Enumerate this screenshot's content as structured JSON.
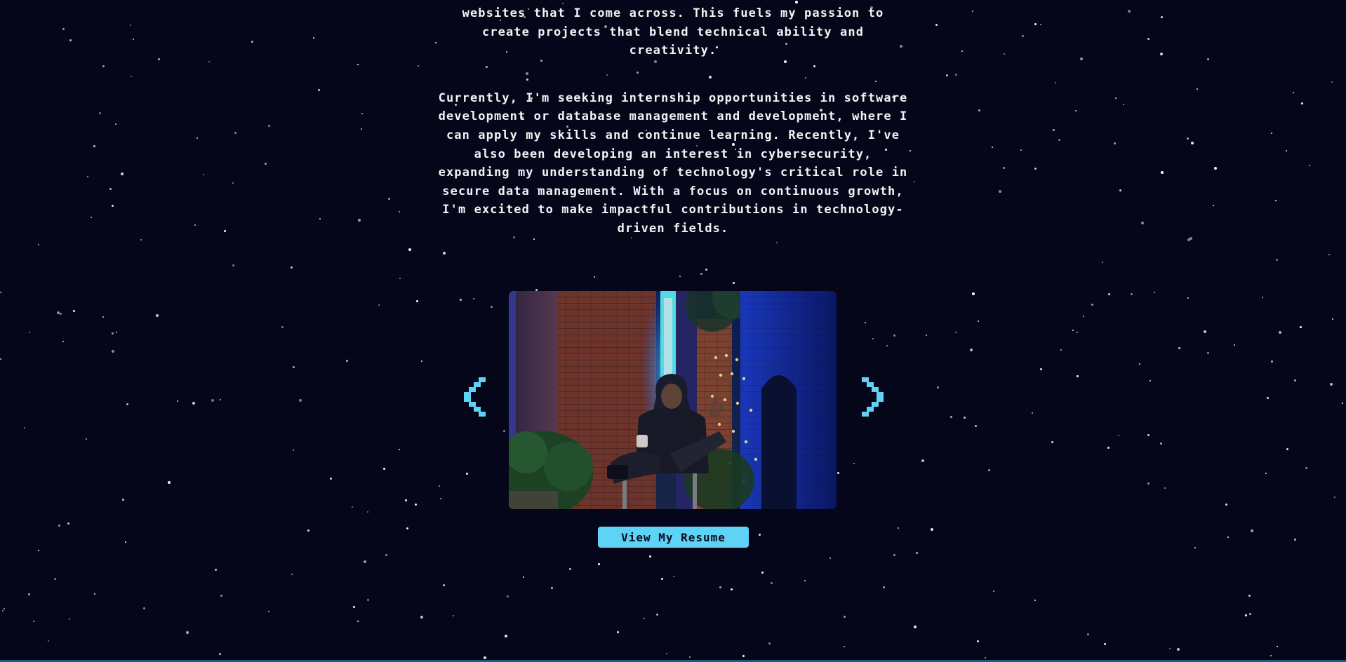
{
  "about": {
    "paragraphs": [
      "websites that I come across. This fuels my passion to create projects that blend technical ability and creativity.",
      "Currently, I'm seeking internship opportunities in software development or database management and development, where I can apply my skills and continue learning. Recently, I've also been developing an interest in cybersecurity, expanding my understanding of technology's critical role in secure data management. With a focus on continuous growth, I'm excited to make impactful contributions in technology-driven fields."
    ]
  },
  "carousel": {
    "prev_icon": "chevron-left-icon",
    "next_icon": "chevron-right-icon"
  },
  "resume_button": {
    "label": "View My Resume"
  },
  "colors": {
    "background": "#05061a",
    "accent": "#5fd3f6",
    "text": "#f3f3f3"
  }
}
